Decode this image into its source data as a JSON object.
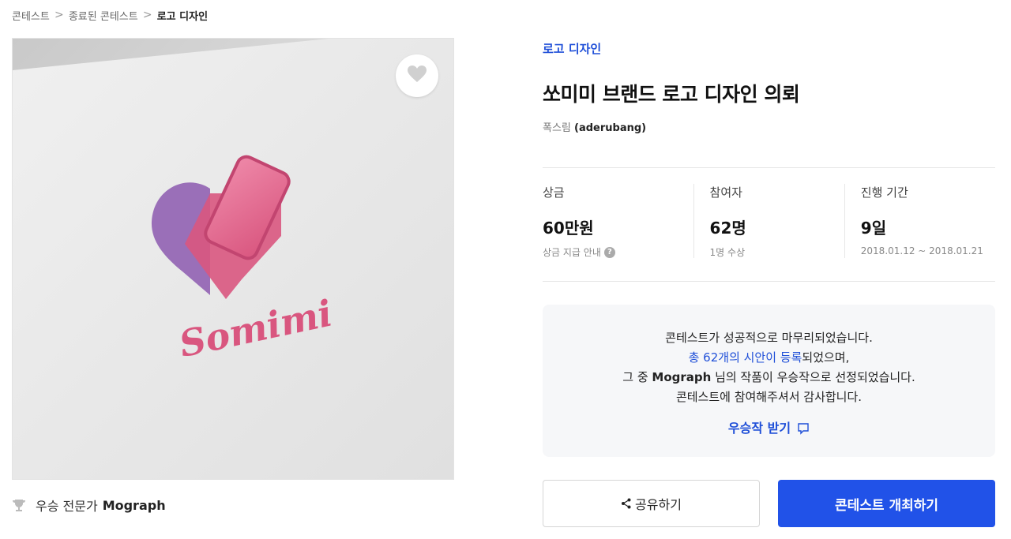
{
  "breadcrumb": {
    "items": [
      "콘테스트",
      "종료된 콘테스트",
      "로고 디자인"
    ],
    "separator": ">"
  },
  "hero": {
    "logo_text": "Somimi",
    "like_icon": "heart-icon"
  },
  "winner": {
    "label": "우승 전문가",
    "name": "Mograph",
    "icon": "trophy-icon"
  },
  "contest": {
    "category": "로고 디자인",
    "title": "쏘미미 브랜드 로고 디자인 의뢰",
    "author_name": "폭스림",
    "author_id": "(aderubang)"
  },
  "stats": {
    "prize": {
      "label": "상금",
      "value": "60만원",
      "sub": "상금 지급 안내",
      "help": "?"
    },
    "participants": {
      "label": "참여자",
      "value": "62명",
      "sub": "1명 수상"
    },
    "duration": {
      "label": "진행 기간",
      "value": "9일",
      "sub": "2018.01.12 ~ 2018.01.21"
    }
  },
  "notice": {
    "line1": "콘테스트가 성공적으로 마무리되었습니다.",
    "line2_link": "총 62개의 시안이 등록",
    "line2_rest": "되었으며,",
    "line3_pre": "그 중 ",
    "line3_name": "Mograph",
    "line3_post": " 님의 작품이 우승작으로 선정되었습니다.",
    "line4": "콘테스트에 참여해주셔서 감사합니다.",
    "cta": "우승작 받기"
  },
  "actions": {
    "share": "공유하기",
    "host": "콘테스트 개최하기"
  },
  "colors": {
    "accent": "#2152e8",
    "link": "#1f4fd8",
    "logo_pink": "#d9567f",
    "logo_purple": "#9a6fb8"
  }
}
